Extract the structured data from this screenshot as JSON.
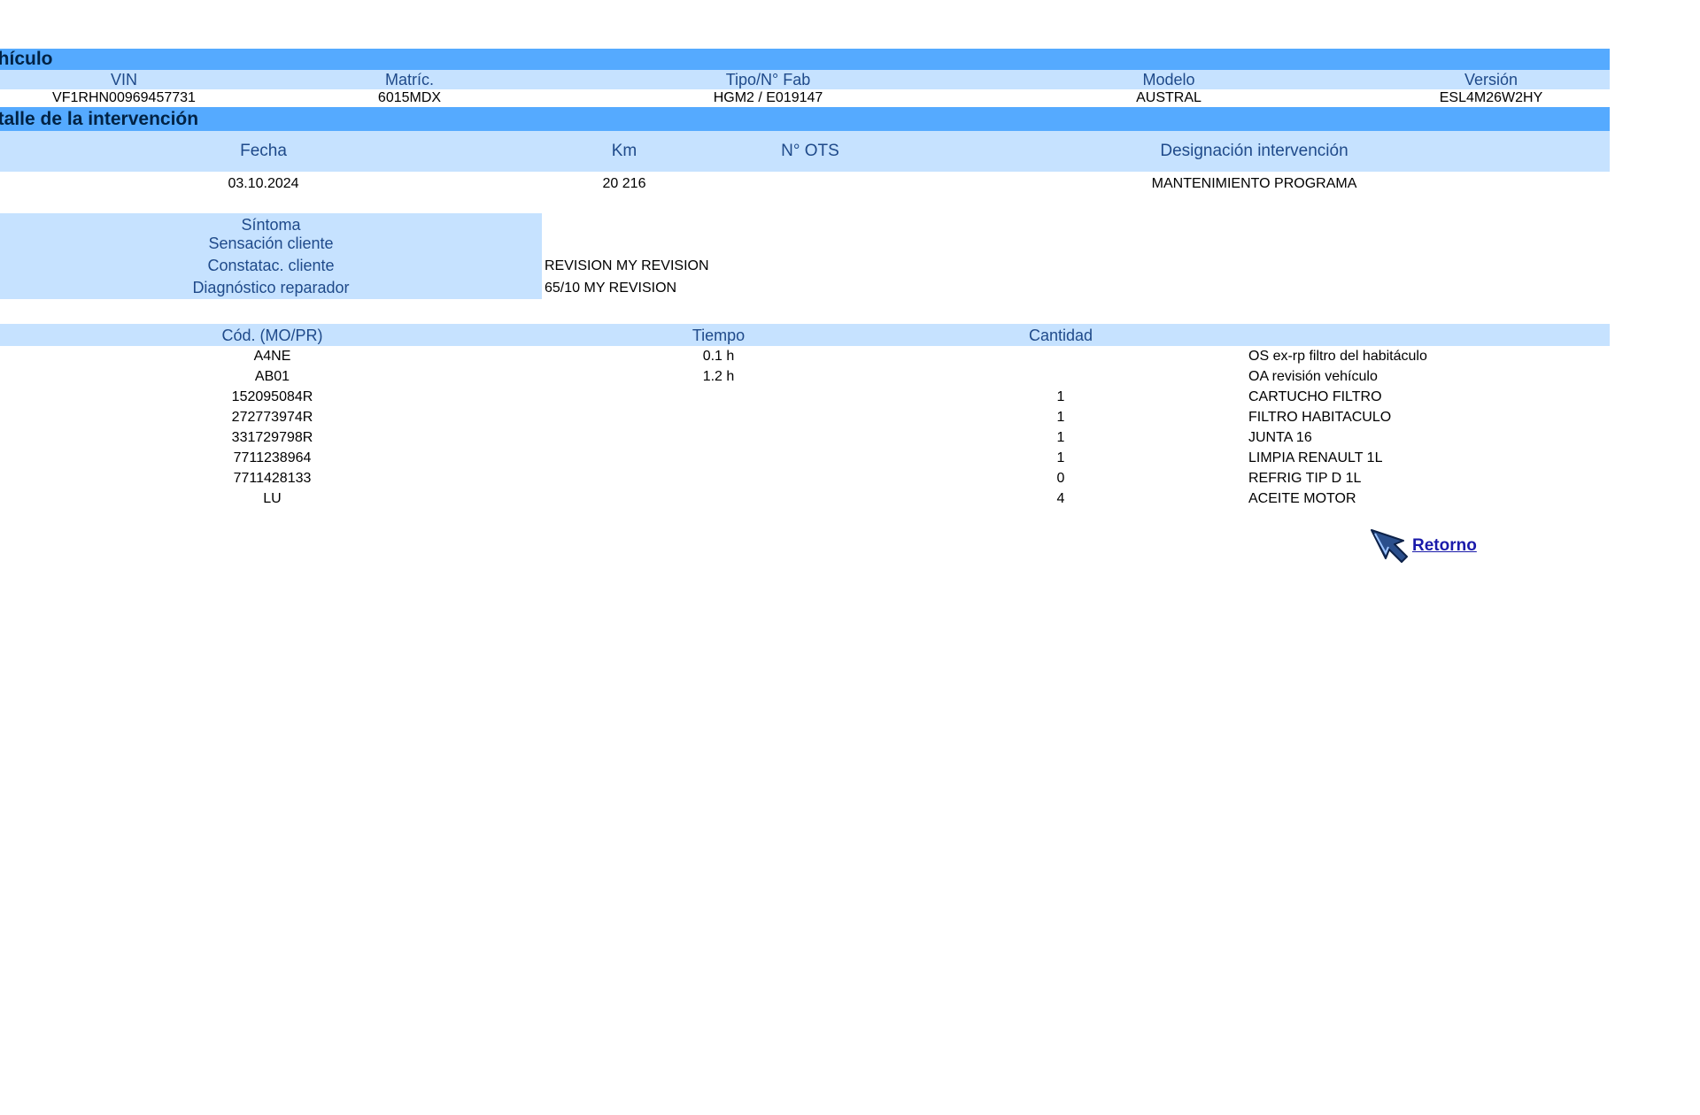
{
  "vehiculo": {
    "title": "ehículo",
    "headers": [
      "VIN",
      "Matríc.",
      "Tipo/N° Fab",
      "Modelo",
      "Versión"
    ],
    "values": [
      "VF1RHN00969457731",
      "6015MDX",
      "HGM2 / E019147",
      "AUSTRAL",
      "ESL4M26W2HY"
    ]
  },
  "intervencion": {
    "title": "etalle de la intervención",
    "headers": [
      "Fecha",
      "Km",
      "N° OTS",
      "Designación intervención"
    ],
    "values": [
      "03.10.2024",
      "20 216",
      "",
      "MANTENIMIENTO PROGRAMA"
    ]
  },
  "sintoma": {
    "labels": [
      "Síntoma",
      "Sensación cliente",
      "Constatac. cliente",
      "Diagnóstico reparador"
    ],
    "values": [
      "",
      "",
      "REVISION MY REVISION",
      "65/10 MY REVISION"
    ]
  },
  "parts": {
    "headers": [
      "Cód. (MO/PR)",
      "Tiempo",
      "Cantidad",
      ""
    ],
    "rows": [
      [
        "A4NE",
        "0.1 h",
        "",
        "OS ex-rp filtro del habitáculo"
      ],
      [
        "AB01",
        "1.2 h",
        "",
        "OA revisión vehículo"
      ],
      [
        "152095084R",
        "",
        "1",
        "CARTUCHO FILTRO"
      ],
      [
        "272773974R",
        "",
        "1",
        "FILTRO HABITACULO"
      ],
      [
        "331729798R",
        "",
        "1",
        "JUNTA 16"
      ],
      [
        "7711238964",
        "",
        "1",
        "LIMPIA RENAULT 1L"
      ],
      [
        "7711428133",
        "",
        "0",
        "REFRIG TIP D 1L"
      ],
      [
        "LU",
        "",
        "4",
        "ACEITE MOTOR"
      ]
    ]
  },
  "retorno": {
    "label": "Retorno",
    "icon": "back-arrow-icon"
  }
}
